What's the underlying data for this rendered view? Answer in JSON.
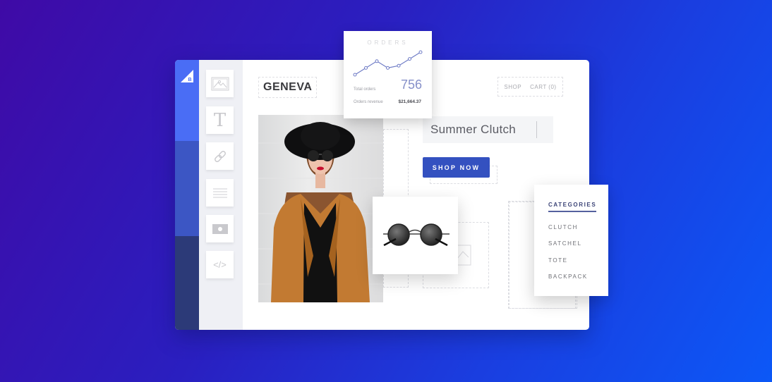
{
  "app": {
    "logo": "bigcommerce-logo",
    "brand_colors": {
      "background_start": "#3f0aa6",
      "background_end": "#0c58f7",
      "button": "#3451c0",
      "rail_top": "#4a6df5"
    }
  },
  "toolbar": {
    "tools": [
      {
        "name": "image-tool",
        "icon": "image-icon"
      },
      {
        "name": "text-tool",
        "icon": "text-icon",
        "glyph": "T"
      },
      {
        "name": "link-tool",
        "icon": "link-icon"
      },
      {
        "name": "paragraph-tool",
        "icon": "paragraph-icon"
      },
      {
        "name": "video-tool",
        "icon": "video-icon"
      },
      {
        "name": "code-tool",
        "icon": "code-icon",
        "glyph": "</>"
      }
    ]
  },
  "store": {
    "brand": "GENEVA",
    "nav": {
      "shop": "SHOP",
      "cart": "CART (0)"
    },
    "hero_heading": "Summer Clutch",
    "cta": "SHOP NOW"
  },
  "orders_widget": {
    "title": "ORDERS",
    "total_orders_label": "Total orders",
    "total_orders_value": "756",
    "revenue_label": "Orders revenue",
    "revenue_value": "$21,664.37",
    "trend": [
      2,
      5,
      8,
      5,
      6,
      9,
      12
    ]
  },
  "categories": {
    "title": "CATEGORIES",
    "items": [
      "CLUTCH",
      "SATCHEL",
      "TOTE",
      "BACKPACK"
    ]
  }
}
